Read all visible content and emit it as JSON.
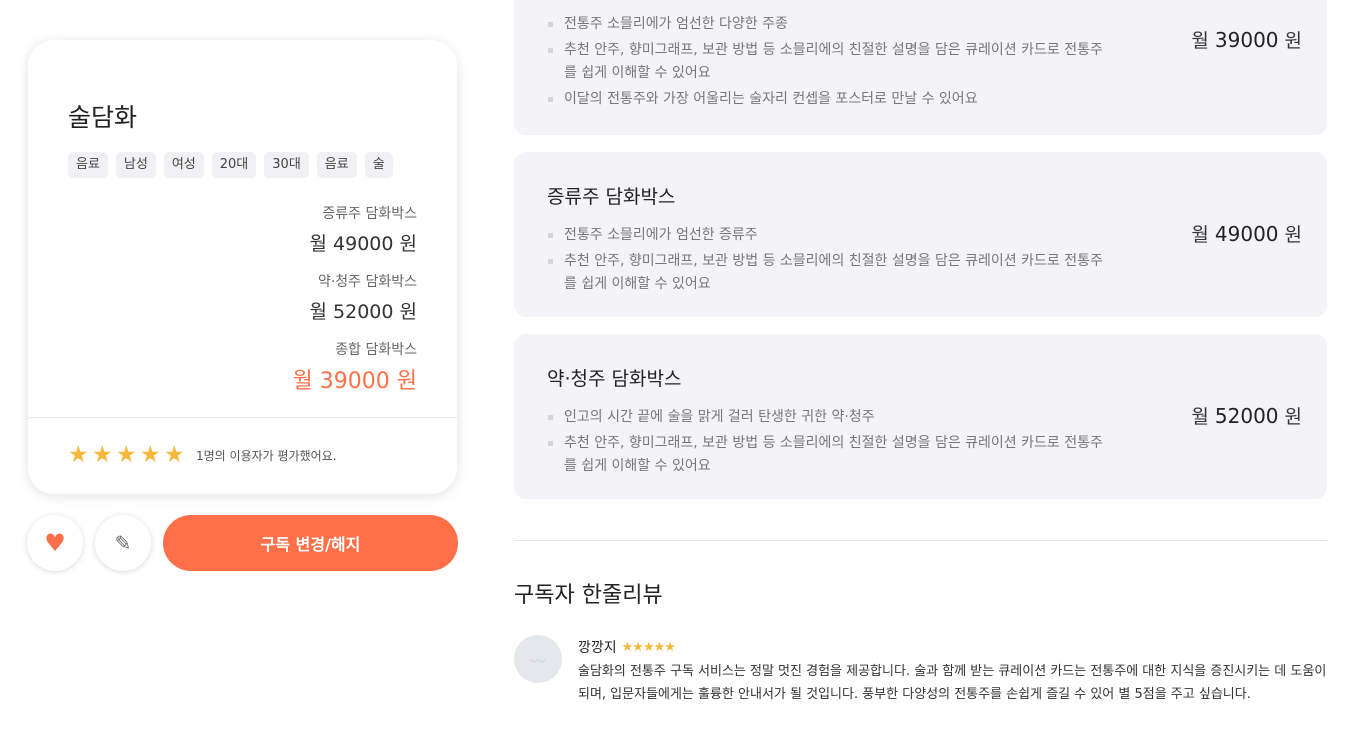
{
  "product": {
    "title": "술담화",
    "tags": [
      "음료",
      "남성",
      "여성",
      "20대",
      "30대",
      "음료",
      "술"
    ],
    "prices": [
      {
        "label": "증류주 담화박스",
        "value": "월 49000 원"
      },
      {
        "label": "약·청주 담화박스",
        "value": "월 52000 원"
      },
      {
        "label": "종합 담화박스",
        "value": "월 39000 원"
      }
    ],
    "rating": {
      "stars": "★★★★★",
      "rated_value": 5,
      "text": "1명의 이용자가 평가했어요."
    }
  },
  "actions": {
    "like_icon": "heart-icon",
    "edit_icon": "pencil-icon",
    "subscribe_label": "구독 변경/해지"
  },
  "boxes": [
    {
      "title": "",
      "features": [
        "전통주 소믈리에가 엄선한 다양한 주종",
        "추천 안주, 향미그래프, 보관 방법 등 소믈리에의 친절한 설명을 담은 큐레이션 카드로 전통주를 쉽게 이해할 수 있어요",
        "이달의 전통주와 가장 어울리는 술자리 컨셉을 포스터로 만날 수 있어요"
      ],
      "price_prefix": "월",
      "price": "39000",
      "price_suffix": "원"
    },
    {
      "title": "증류주 담화박스",
      "features": [
        "전통주 소믈리에가 엄선한 증류주",
        "추천 안주, 향미그래프, 보관 방법 등 소믈리에의 친절한 설명을 담은 큐레이션 카드로 전통주를 쉽게 이해할 수 있어요"
      ],
      "price_prefix": "월",
      "price": "49000",
      "price_suffix": "원"
    },
    {
      "title": "약·청주 담화박스",
      "features": [
        "인고의 시간 끝에 술을 맑게 걸러 탄생한 귀한 약·청주",
        "추천 안주, 향미그래프, 보관 방법 등 소믈리에의 친절한 설명을 담은 큐레이션 카드로 전통주를 쉽게 이해할 수 있어요"
      ],
      "price_prefix": "월",
      "price": "52000",
      "price_suffix": "원"
    }
  ],
  "reviews": {
    "title": "구독자 한줄리뷰",
    "items": [
      {
        "avatar_icon": "user-avatar-icon",
        "name": "깡깡지",
        "stars": "★★★★★",
        "text": "술담화의 전통주 구독 서비스는 정말 멋진 경험을 제공합니다. 술과 함께 받는 큐레이션 카드는 전통주에 대한 지식을 증진시키는 데 도움이 되며, 입문자들에게는 훌륭한 안내서가 될 것입니다. 풍부한 다양성의 전통주를 손쉽게 즐길 수 있어 별 5점을 주고 싶습니다."
      }
    ]
  },
  "colors": {
    "accent": "#ff7049",
    "star": "#f6b93b",
    "box_bg": "#f4f4f8"
  }
}
